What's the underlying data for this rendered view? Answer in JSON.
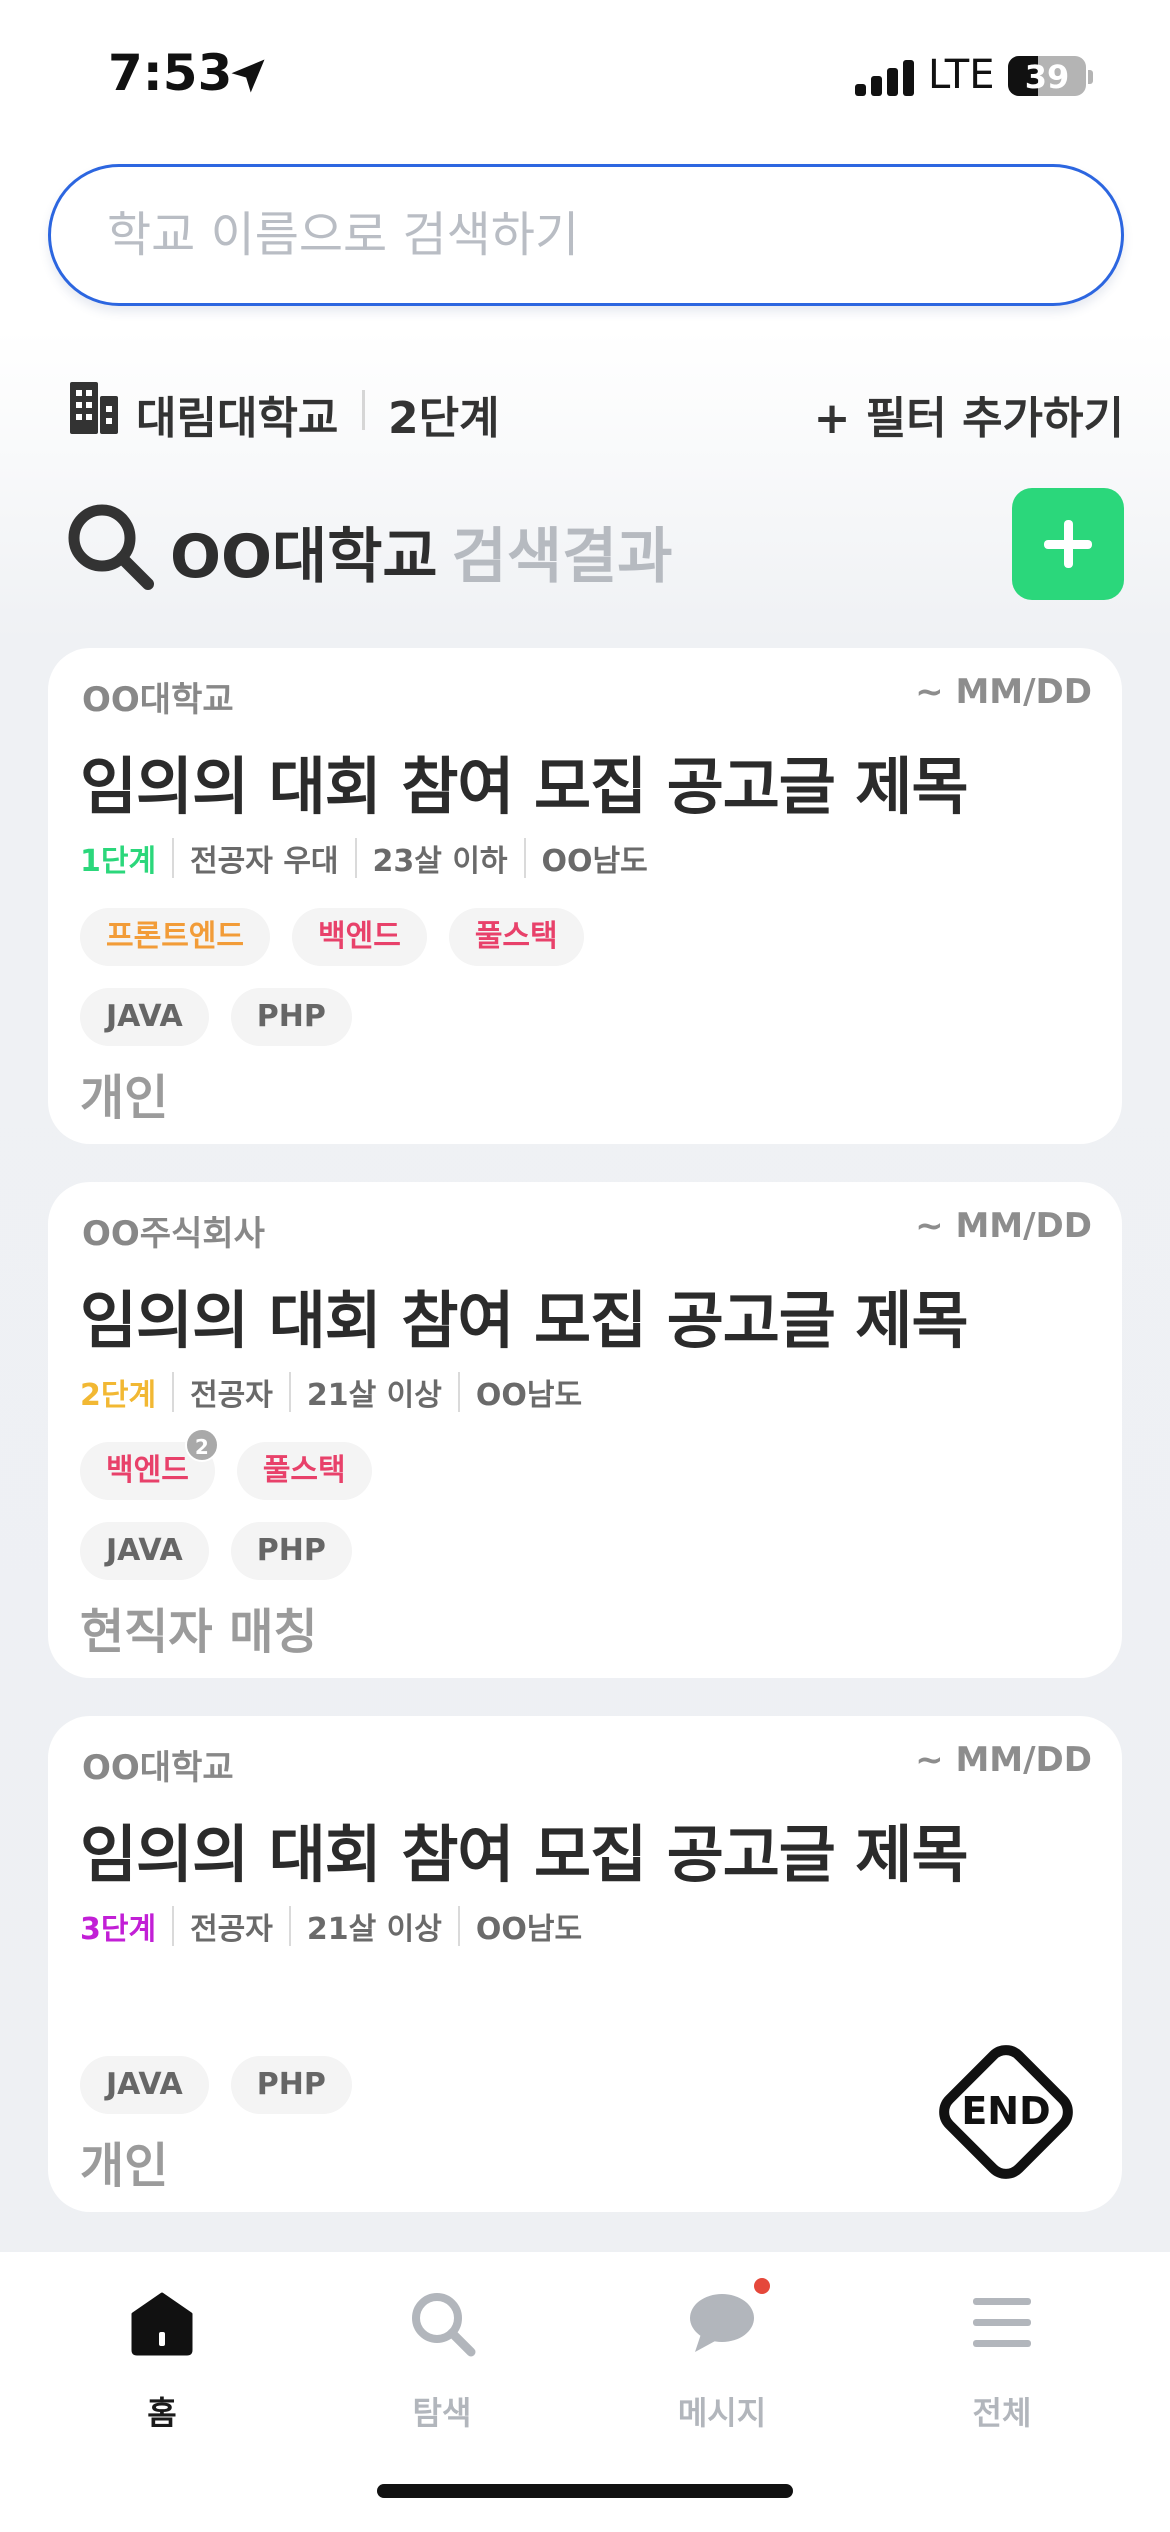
{
  "status_bar": {
    "time": "7:53",
    "network": "LTE",
    "battery": "39",
    "battery_fraction": 0.39
  },
  "search": {
    "placeholder": "학교 이름으로 검색하기",
    "value": ""
  },
  "filters": {
    "school": "대림대학교",
    "stage": "2단계",
    "add_filter": "+ 필터 추가하기"
  },
  "results": {
    "query": "OO대학교",
    "suffix": "검색결과"
  },
  "colors": {
    "accent_green": "#2bd77b",
    "search_border": "#2c66e0",
    "stage1": "#2bd77b",
    "stage2": "#f2b833",
    "stage3": "#c21fd6",
    "tag_orange": "#f29c38",
    "tag_red": "#e8416a",
    "notification": "#e5483b"
  },
  "cards": [
    {
      "org": "OO대학교",
      "due": "~ MM/DD",
      "title": "임의의 대회 참여 모집 공고글 제목",
      "stage": "1단계",
      "meta": [
        "전공자 우대",
        "23살 이하",
        "OO남도"
      ],
      "roles": [
        {
          "label": "프론트엔드",
          "color": "#f29c38"
        },
        {
          "label": "백엔드",
          "color": "#e8416a"
        },
        {
          "label": "풀스택",
          "color": "#e8416a"
        }
      ],
      "skills": [
        "JAVA",
        "PHP"
      ],
      "team": "개인"
    },
    {
      "org": "OO주식회사",
      "due": "~ MM/DD",
      "title": "임의의 대회 참여 모집 공고글 제목",
      "stage": "2단계",
      "meta": [
        "전공자",
        "21살 이상",
        "OO남도"
      ],
      "roles": [
        {
          "label": "백엔드",
          "color": "#e8416a",
          "badge": "2"
        },
        {
          "label": "풀스택",
          "color": "#e8416a"
        }
      ],
      "skills": [
        "JAVA",
        "PHP"
      ],
      "team": "현직자 매칭"
    },
    {
      "org": "OO대학교",
      "due": "~ MM/DD",
      "title": "임의의 대회 참여 모집 공고글 제목",
      "stage": "3단계",
      "meta": [
        "전공자",
        "21살 이상",
        "OO남도"
      ],
      "skills": [
        "JAVA",
        "PHP"
      ],
      "team": "개인",
      "end_label": "END"
    }
  ],
  "tab_bar": {
    "items": [
      {
        "label": "홈",
        "icon": "home-icon"
      },
      {
        "label": "탐색",
        "icon": "search-icon"
      },
      {
        "label": "메시지",
        "icon": "chat-icon"
      },
      {
        "label": "전체",
        "icon": "menu-icon"
      }
    ]
  }
}
